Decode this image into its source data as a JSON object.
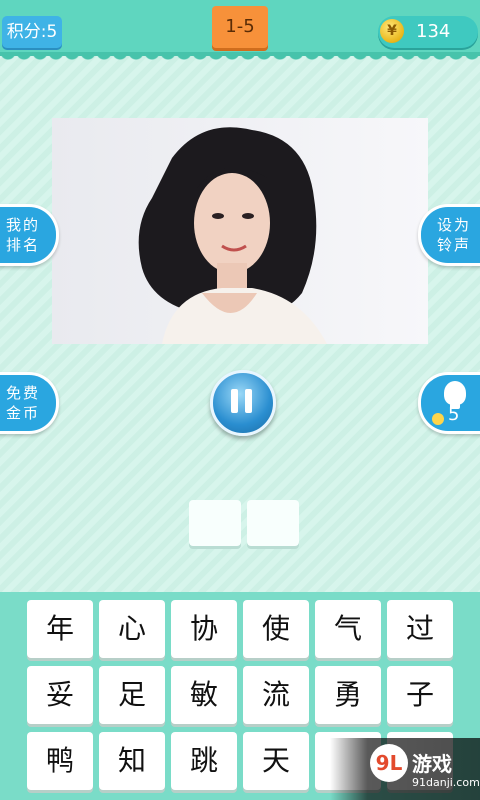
{
  "header": {
    "score_label": "积分:5",
    "level_label": "1-5",
    "coin_icon_glyph": "¥",
    "coin_count": "134"
  },
  "side_buttons": {
    "ranking": "我的排名",
    "ringtone": "设为铃声",
    "free_coins": "免费金币",
    "hint_count": "5"
  },
  "colors": {
    "topbar": "#5fd6bf",
    "accent_blue": "#2aa6e0",
    "level_orange": "#f7913a",
    "keyboard_bg": "#7adcc8"
  },
  "keys": [
    "年",
    "心",
    "协",
    "使",
    "气",
    "过",
    "妥",
    "足",
    "敏",
    "流",
    "勇",
    "子",
    "鸭",
    "知",
    "跳",
    "天",
    "",
    ""
  ],
  "watermark": {
    "logo": "9L",
    "name": "游戏",
    "url": "91danji.com"
  }
}
